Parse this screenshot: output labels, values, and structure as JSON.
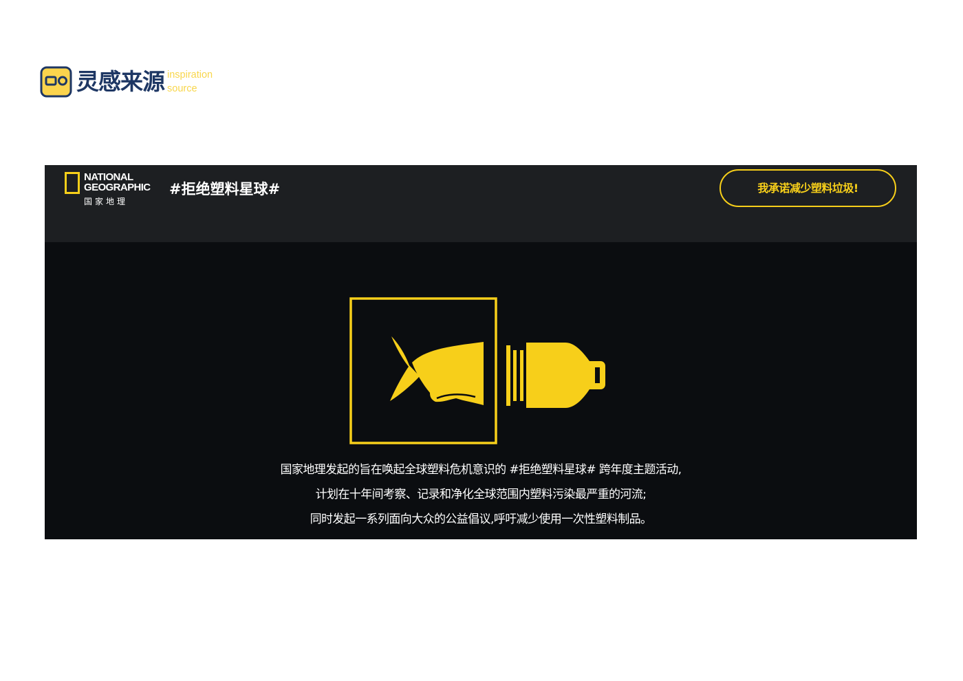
{
  "brand": {
    "name": "灵感来源",
    "tagline_line1": "inspiration",
    "tagline_line2": "source"
  },
  "banner": {
    "logo": {
      "line1": "NATIONAL",
      "line2": "GEOGRAPHIC",
      "chinese": "国家地理"
    },
    "title": "#拒绝塑料星球#",
    "pledge_button_label": "我承诺减少塑料垃圾!",
    "illustration_icon": "fish-in-plastic-bottle-icon",
    "description": [
      "国家地理发起的旨在唤起全球塑料危机意识的 #拒绝塑料星球# 跨年度主题活动,",
      "计划在十年间考察、记录和净化全球范围内塑料污染最严重的河流;",
      "同时发起一系列面向大众的公益倡议,呼吁减少使用一次性塑料制品。"
    ]
  },
  "colors": {
    "accent_yellow": "#f7cf1a",
    "brand_navy": "#1e3764",
    "banner_background": "#0b0d10",
    "banner_header_background": "#1d1f22"
  }
}
